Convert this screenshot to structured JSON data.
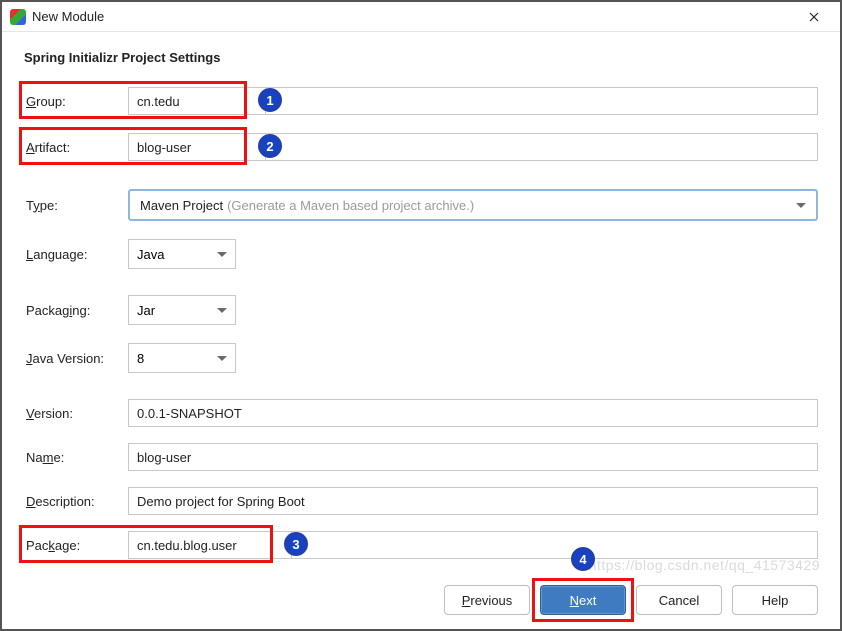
{
  "window": {
    "title": "New Module"
  },
  "heading": "Spring Initializr Project Settings",
  "labels": {
    "group": "Group:",
    "artifact": "Artifact:",
    "type": "Type:",
    "language": "Language:",
    "packaging": "Packaging:",
    "javaVersion": "Java Version:",
    "version": "Version:",
    "name": "Name:",
    "description": "Description:",
    "package": "Package:"
  },
  "fields": {
    "group": "cn.tedu",
    "artifact": "blog-user",
    "type": {
      "main": "Maven Project",
      "hint": "(Generate a Maven based project archive.)"
    },
    "language": "Java",
    "packaging": "Jar",
    "javaVersion": "8",
    "version": "0.0.1-SNAPSHOT",
    "name": "blog-user",
    "description": "Demo project for Spring Boot",
    "package": "cn.tedu.blog.user"
  },
  "buttons": {
    "previous": "Previous",
    "next": "Next",
    "cancel": "Cancel",
    "help": "Help"
  },
  "badges": {
    "b1": "1",
    "b2": "2",
    "b3": "3",
    "b4": "4"
  },
  "watermark": "https://blog.csdn.net/qq_41573429"
}
